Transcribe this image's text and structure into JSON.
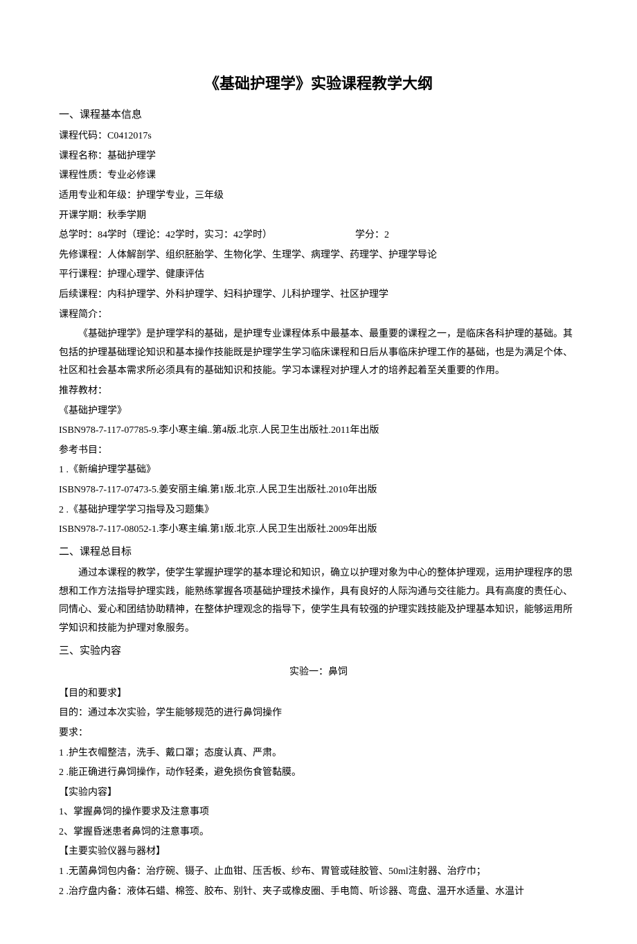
{
  "title": "《基础护理学》实验课程教学大纲",
  "s1": {
    "header": "一、课程基本信息",
    "code_label": "课程代码：",
    "code": "C0412017s",
    "name_label": "课程名称：",
    "name": "基础护理学",
    "nature_label": "课程性质：",
    "nature": "专业必修课",
    "apply_label": "适用专业和年级：",
    "apply": "护理学专业，三年级",
    "term_label": "开课学期：",
    "term": "秋季学期",
    "hours_label": "总学时：",
    "hours": "84学时（理论：42学时，实习：42学时）",
    "credit_label": "学分：",
    "credit": "2",
    "pre_label": "先修课程：",
    "pre": "人体解剖学、组织胚胎学、生物化学、生理学、病理学、药理学、护理学导论",
    "par_label": "平行课程：",
    "par": "护理心理学、健康评估",
    "post_label": "后续课程：",
    "post": "内科护理学、外科护理学、妇科护理学、儿科护理学、社区护理学",
    "intro_label": "课程简介：",
    "intro": "《基础护理学》是护理学科的基础，是护理专业课程体系中最基本、最重要的课程之一，是临床各科护理的基础。其包括的护理基础理论知识和基本操作技能既是护理学生学习临床课程和日后从事临床护理工作的基础，也是为满足个体、社区和社会基本需求所必须具有的基础知识和技能。学习本课程对护理人才的培养起着至关重要的作用。",
    "textbook_label": "推荐教材：",
    "textbook_title": "《基础护理学》",
    "textbook_info": "ISBN978-7-117-07785-9.李小寒主编..第4版.北京.人民卫生出版社.2011年出版",
    "ref_label": "参考书目：",
    "ref1_num": "1 .",
    "ref1_title": "《新编护理学基础》",
    "ref1_info": "ISBN978-7-117-07473-5.姜安丽主编.第1版.北京.人民卫生出版社.2010年出版",
    "ref2_num": "2 .",
    "ref2_title": "《基础护理学学习指导及习题集》",
    "ref2_info": "ISBN978-7-117-08052-1.李小寒主编.第1版.北京.人民卫生出版社.2009年出版"
  },
  "s2": {
    "header": "二、课程总目标",
    "body": "通过本课程的教学，使学生掌握护理学的基本理论和知识，确立以护理对象为中心的整体护理观，运用护理程序的思想和工作方法指导护理实践，能熟练掌握各项基础护理技术操作，具有良好的人际沟通与交往能力。具有高度的责任心、同情心、爱心和团结协助精神，在整体护理观念的指导下，使学生具有较强的护理实践技能及护理基本知识，能够运用所学知识和技能为护理对象服务。"
  },
  "s3": {
    "header": "三、实验内容",
    "exp_title": "实验一：鼻饲",
    "purpose_header": "【目的和要求】",
    "purpose": "目的：通过本次实验，学生能够规范的进行鼻饲操作",
    "req_label": "要求：",
    "req1": "1 .护生衣帽整洁，洗手、戴口罩；态度认真、严肃。",
    "req2": "2 .能正确进行鼻饲操作，动作轻柔，避免损伤食管黏膜。",
    "content_header": "【实验内容】",
    "content1": "1、掌握鼻饲的操作要求及注意事项",
    "content2": "2、掌握昏迷患者鼻饲的注意事项。",
    "instr_header": "【主要实验仪器与器材】",
    "instr1": "1 .无菌鼻饲包内备：治疗碗、镊子、止血钳、压舌板、纱布、胃管或硅胶管、50ml注射器、治疗巾；",
    "instr2": "2 .治疗盘内备：液体石蜡、棉签、胶布、别针、夹子或橡皮圈、手电筒、听诊器、弯盘、温开水适量、水温计"
  }
}
